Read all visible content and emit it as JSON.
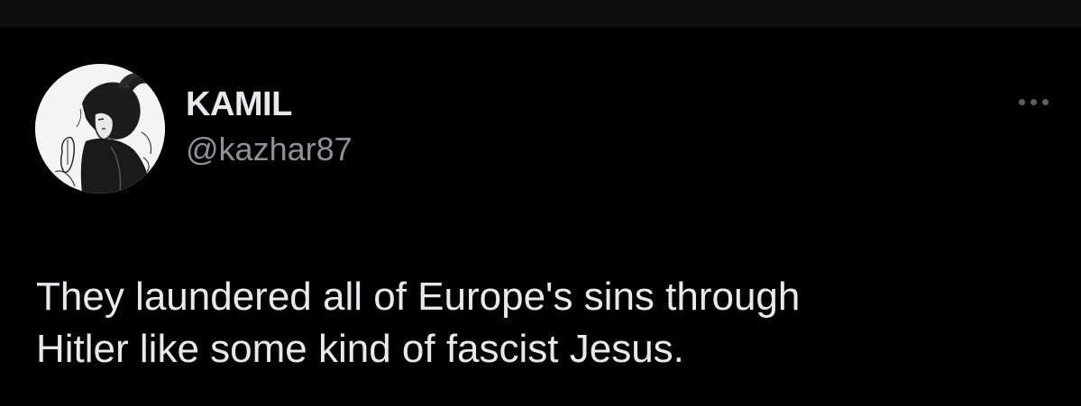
{
  "tweet": {
    "author": {
      "display_name": "KAMIL",
      "handle": "@kazhar87",
      "avatar_icon": "manga-character-avatar-icon"
    },
    "more_icon": "more-options-icon",
    "text_lines": [
      "They laundered all of Europe's sins through",
      "Hitler like some kind of fascist Jesus."
    ]
  },
  "colors": {
    "background": "#000000",
    "top_strip": "#0e0e0e",
    "primary_text": "#e7e9ea",
    "secondary_text": "#8b9196",
    "icon_muted": "#5b6065",
    "avatar_bg": "#f4f4f4"
  }
}
